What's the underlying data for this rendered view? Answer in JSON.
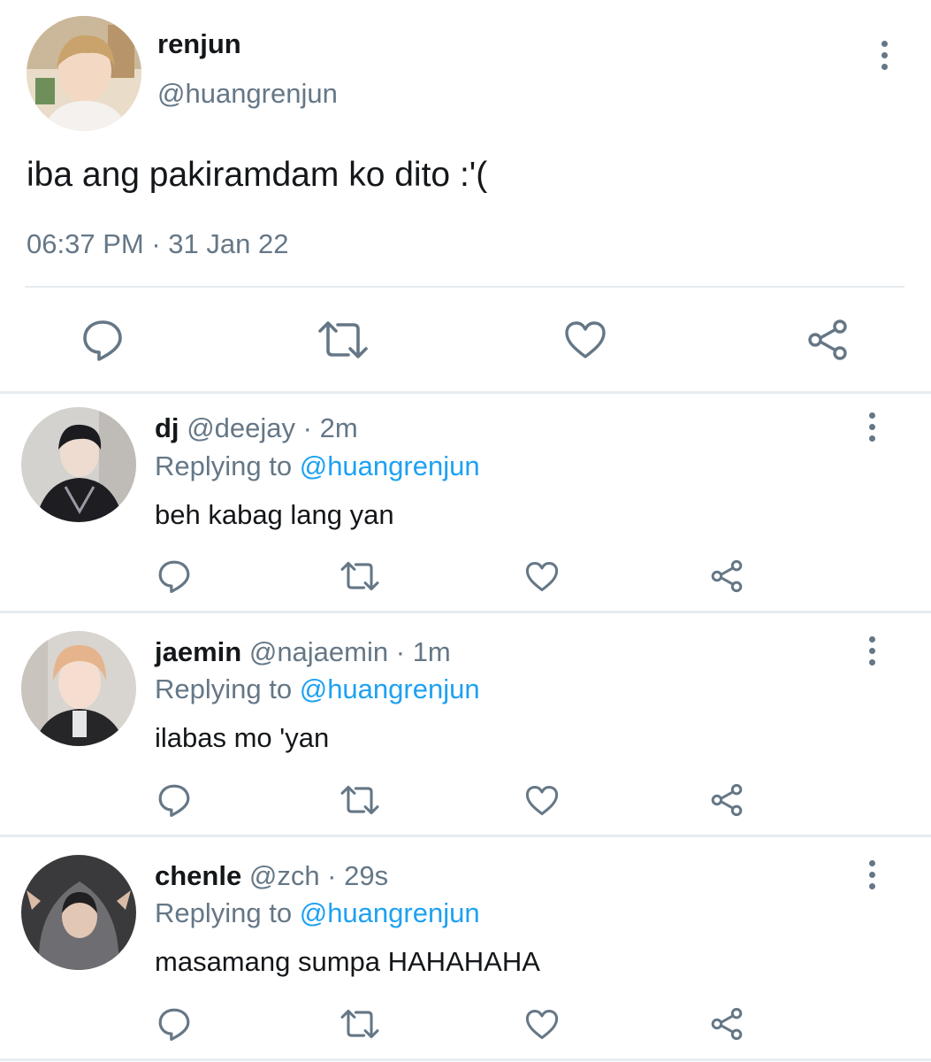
{
  "tweet": {
    "name": "renjun",
    "handle": "@huangrenjun",
    "text": "iba ang pakiramdam ko dito :'(",
    "time": "06:37 PM",
    "date_sep": " · ",
    "date": "31 Jan 22"
  },
  "replies": [
    {
      "name": "dj",
      "handle": "@deejay",
      "age": "2m",
      "replying_prefix": "Replying to ",
      "replying_to": "@huangrenjun",
      "text": "beh kabag lang yan"
    },
    {
      "name": "jaemin",
      "handle": "@najaemin",
      "age": "1m",
      "replying_prefix": "Replying to ",
      "replying_to": "@huangrenjun",
      "text": "ilabas mo 'yan"
    },
    {
      "name": "chenle",
      "handle": "@zch",
      "age": "29s",
      "replying_prefix": "Replying to ",
      "replying_to": "@huangrenjun",
      "text": "masamang sumpa HAHAHAHA"
    }
  ],
  "icons": {
    "reply": "speech-bubble-icon",
    "retweet": "retweet-arrows-icon",
    "like": "heart-icon",
    "share": "share-nodes-icon",
    "more": "vertical-ellipsis-icon"
  },
  "colors": {
    "text": "#14171a",
    "secondary": "#657786",
    "link": "#1da1f2",
    "divider": "#e6ecf0"
  }
}
